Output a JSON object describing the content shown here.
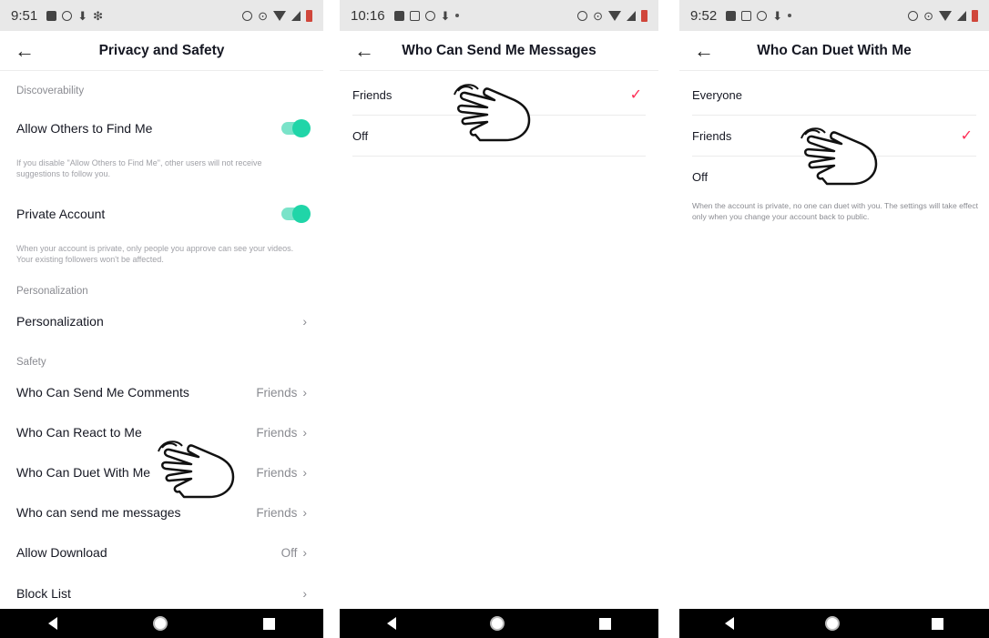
{
  "screen1": {
    "status": {
      "time": "9:51"
    },
    "title": "Privacy and Safety",
    "sections": {
      "discoverability": "Discoverability",
      "personalization": "Personalization",
      "safety": "Safety"
    },
    "allow_find": {
      "label": "Allow Others to Find Me",
      "enabled": true,
      "desc": "If you disable \"Allow Others to Find Me\", other users will not receive suggestions to follow you."
    },
    "private_account": {
      "label": "Private Account",
      "enabled": true,
      "desc": "When your account is private, only people you approve can see your videos. Your existing followers won't be affected."
    },
    "personalization_item": "Personalization",
    "items": [
      {
        "label": "Who Can Send Me Comments",
        "value": "Friends"
      },
      {
        "label": "Who Can React to Me",
        "value": "Friends"
      },
      {
        "label": "Who Can Duet With Me",
        "value": "Friends"
      },
      {
        "label": "Who can send me messages",
        "value": "Friends"
      },
      {
        "label": "Allow Download",
        "value": "Off"
      },
      {
        "label": "Block List",
        "value": ""
      }
    ]
  },
  "screen2": {
    "status": {
      "time": "10:16"
    },
    "title": "Who Can Send Me Messages",
    "options": [
      {
        "label": "Friends",
        "selected": true
      },
      {
        "label": "Off",
        "selected": false
      }
    ]
  },
  "screen3": {
    "status": {
      "time": "9:52"
    },
    "title": "Who Can Duet With Me",
    "options": [
      {
        "label": "Everyone",
        "selected": false
      },
      {
        "label": "Friends",
        "selected": true
      },
      {
        "label": "Off",
        "selected": false
      }
    ],
    "note": "When the account is private, no one can duet with you. The settings will take effect only when you change your account back to public."
  },
  "icons": {
    "back": "←",
    "chevron": "›",
    "check": "✓"
  },
  "colors": {
    "toggle_on": "#20d5a8",
    "check": "#fe2c55",
    "statusbar": "#e8e8e8"
  }
}
